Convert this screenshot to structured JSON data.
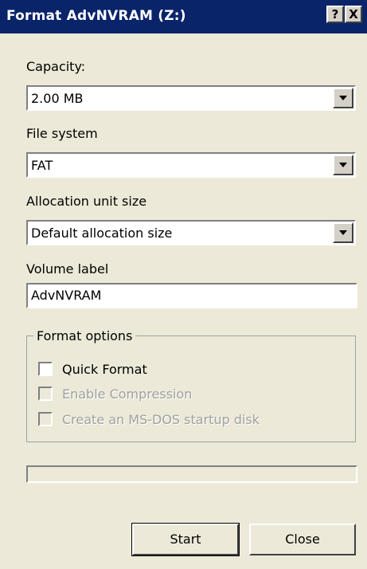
{
  "window": {
    "title": "Format AdvNVRAM (Z:)",
    "help_glyph": "?",
    "close_glyph": "X"
  },
  "capacity": {
    "label": "Capacity:",
    "value": "2.00 MB"
  },
  "file_system": {
    "label": "File system",
    "value": "FAT"
  },
  "allocation": {
    "label": "Allocation unit size",
    "value": "Default allocation size"
  },
  "volume_label": {
    "label": "Volume label",
    "value": "AdvNVRAM"
  },
  "format_options": {
    "legend": "Format options",
    "quick_format": {
      "label": "Quick Format",
      "checked": false,
      "enabled": true
    },
    "enable_compression": {
      "label": "Enable Compression",
      "checked": false,
      "enabled": false
    },
    "msdos_startup": {
      "label": "Create an MS-DOS startup disk",
      "checked": false,
      "enabled": false
    }
  },
  "progress": {
    "fraction": 0
  },
  "buttons": {
    "start": "Start",
    "close": "Close"
  },
  "colors": {
    "titlebar": "#0a246a",
    "face": "#ece9d8",
    "disabled_text": "#a0a0a0"
  }
}
